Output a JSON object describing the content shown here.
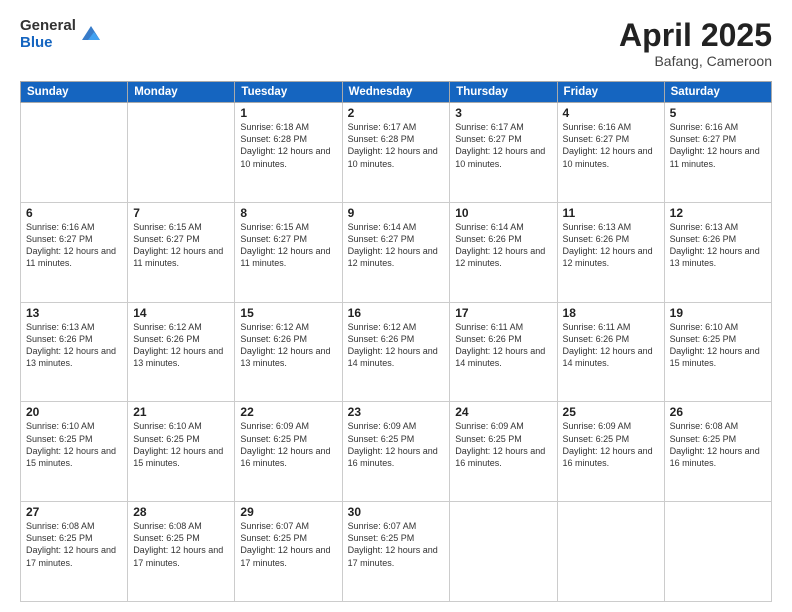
{
  "header": {
    "logo_general": "General",
    "logo_blue": "Blue",
    "title": "April 2025",
    "location": "Bafang, Cameroon"
  },
  "weekdays": [
    "Sunday",
    "Monday",
    "Tuesday",
    "Wednesday",
    "Thursday",
    "Friday",
    "Saturday"
  ],
  "weeks": [
    [
      null,
      null,
      {
        "day": "1",
        "sunrise": "Sunrise: 6:18 AM",
        "sunset": "Sunset: 6:28 PM",
        "daylight": "Daylight: 12 hours and 10 minutes."
      },
      {
        "day": "2",
        "sunrise": "Sunrise: 6:17 AM",
        "sunset": "Sunset: 6:28 PM",
        "daylight": "Daylight: 12 hours and 10 minutes."
      },
      {
        "day": "3",
        "sunrise": "Sunrise: 6:17 AM",
        "sunset": "Sunset: 6:27 PM",
        "daylight": "Daylight: 12 hours and 10 minutes."
      },
      {
        "day": "4",
        "sunrise": "Sunrise: 6:16 AM",
        "sunset": "Sunset: 6:27 PM",
        "daylight": "Daylight: 12 hours and 10 minutes."
      },
      {
        "day": "5",
        "sunrise": "Sunrise: 6:16 AM",
        "sunset": "Sunset: 6:27 PM",
        "daylight": "Daylight: 12 hours and 11 minutes."
      }
    ],
    [
      {
        "day": "6",
        "sunrise": "Sunrise: 6:16 AM",
        "sunset": "Sunset: 6:27 PM",
        "daylight": "Daylight: 12 hours and 11 minutes."
      },
      {
        "day": "7",
        "sunrise": "Sunrise: 6:15 AM",
        "sunset": "Sunset: 6:27 PM",
        "daylight": "Daylight: 12 hours and 11 minutes."
      },
      {
        "day": "8",
        "sunrise": "Sunrise: 6:15 AM",
        "sunset": "Sunset: 6:27 PM",
        "daylight": "Daylight: 12 hours and 11 minutes."
      },
      {
        "day": "9",
        "sunrise": "Sunrise: 6:14 AM",
        "sunset": "Sunset: 6:27 PM",
        "daylight": "Daylight: 12 hours and 12 minutes."
      },
      {
        "day": "10",
        "sunrise": "Sunrise: 6:14 AM",
        "sunset": "Sunset: 6:26 PM",
        "daylight": "Daylight: 12 hours and 12 minutes."
      },
      {
        "day": "11",
        "sunrise": "Sunrise: 6:13 AM",
        "sunset": "Sunset: 6:26 PM",
        "daylight": "Daylight: 12 hours and 12 minutes."
      },
      {
        "day": "12",
        "sunrise": "Sunrise: 6:13 AM",
        "sunset": "Sunset: 6:26 PM",
        "daylight": "Daylight: 12 hours and 13 minutes."
      }
    ],
    [
      {
        "day": "13",
        "sunrise": "Sunrise: 6:13 AM",
        "sunset": "Sunset: 6:26 PM",
        "daylight": "Daylight: 12 hours and 13 minutes."
      },
      {
        "day": "14",
        "sunrise": "Sunrise: 6:12 AM",
        "sunset": "Sunset: 6:26 PM",
        "daylight": "Daylight: 12 hours and 13 minutes."
      },
      {
        "day": "15",
        "sunrise": "Sunrise: 6:12 AM",
        "sunset": "Sunset: 6:26 PM",
        "daylight": "Daylight: 12 hours and 13 minutes."
      },
      {
        "day": "16",
        "sunrise": "Sunrise: 6:12 AM",
        "sunset": "Sunset: 6:26 PM",
        "daylight": "Daylight: 12 hours and 14 minutes."
      },
      {
        "day": "17",
        "sunrise": "Sunrise: 6:11 AM",
        "sunset": "Sunset: 6:26 PM",
        "daylight": "Daylight: 12 hours and 14 minutes."
      },
      {
        "day": "18",
        "sunrise": "Sunrise: 6:11 AM",
        "sunset": "Sunset: 6:26 PM",
        "daylight": "Daylight: 12 hours and 14 minutes."
      },
      {
        "day": "19",
        "sunrise": "Sunrise: 6:10 AM",
        "sunset": "Sunset: 6:25 PM",
        "daylight": "Daylight: 12 hours and 15 minutes."
      }
    ],
    [
      {
        "day": "20",
        "sunrise": "Sunrise: 6:10 AM",
        "sunset": "Sunset: 6:25 PM",
        "daylight": "Daylight: 12 hours and 15 minutes."
      },
      {
        "day": "21",
        "sunrise": "Sunrise: 6:10 AM",
        "sunset": "Sunset: 6:25 PM",
        "daylight": "Daylight: 12 hours and 15 minutes."
      },
      {
        "day": "22",
        "sunrise": "Sunrise: 6:09 AM",
        "sunset": "Sunset: 6:25 PM",
        "daylight": "Daylight: 12 hours and 16 minutes."
      },
      {
        "day": "23",
        "sunrise": "Sunrise: 6:09 AM",
        "sunset": "Sunset: 6:25 PM",
        "daylight": "Daylight: 12 hours and 16 minutes."
      },
      {
        "day": "24",
        "sunrise": "Sunrise: 6:09 AM",
        "sunset": "Sunset: 6:25 PM",
        "daylight": "Daylight: 12 hours and 16 minutes."
      },
      {
        "day": "25",
        "sunrise": "Sunrise: 6:09 AM",
        "sunset": "Sunset: 6:25 PM",
        "daylight": "Daylight: 12 hours and 16 minutes."
      },
      {
        "day": "26",
        "sunrise": "Sunrise: 6:08 AM",
        "sunset": "Sunset: 6:25 PM",
        "daylight": "Daylight: 12 hours and 16 minutes."
      }
    ],
    [
      {
        "day": "27",
        "sunrise": "Sunrise: 6:08 AM",
        "sunset": "Sunset: 6:25 PM",
        "daylight": "Daylight: 12 hours and 17 minutes."
      },
      {
        "day": "28",
        "sunrise": "Sunrise: 6:08 AM",
        "sunset": "Sunset: 6:25 PM",
        "daylight": "Daylight: 12 hours and 17 minutes."
      },
      {
        "day": "29",
        "sunrise": "Sunrise: 6:07 AM",
        "sunset": "Sunset: 6:25 PM",
        "daylight": "Daylight: 12 hours and 17 minutes."
      },
      {
        "day": "30",
        "sunrise": "Sunrise: 6:07 AM",
        "sunset": "Sunset: 6:25 PM",
        "daylight": "Daylight: 12 hours and 17 minutes."
      },
      null,
      null,
      null
    ]
  ]
}
